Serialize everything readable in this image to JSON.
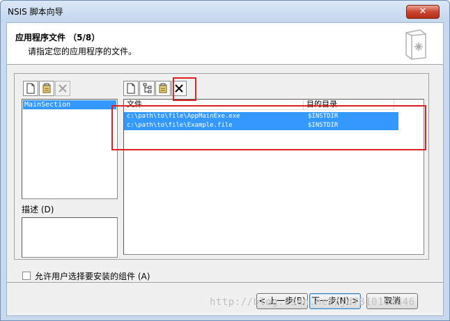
{
  "window": {
    "title": "NSIS 脚本向导",
    "close_glyph": "✕"
  },
  "header": {
    "title": "应用程序文件 （5/8）",
    "subtitle": "请指定您的应用程序的文件。"
  },
  "sections_panel": {
    "items": [
      "MainSection"
    ],
    "description_label": "描述 (D)"
  },
  "files_panel": {
    "columns": [
      "文件",
      "目的目录"
    ],
    "rows": [
      {
        "file": "c:\\path\\to\\file\\AppMainExe.exe",
        "dest": "$INSTDIR"
      },
      {
        "file": "c:\\path\\to\\file\\Example.file",
        "dest": "$INSTDIR"
      }
    ]
  },
  "options": {
    "allow_select_label": "允许用户选择要安装的组件 (A)"
  },
  "buttons": {
    "back": "< 上一步(B)",
    "next": "下一步(N) >",
    "cancel": "取消"
  },
  "watermark": "http://blog.csdn.net/jd7810184446",
  "colors": {
    "selection": "#3399ff",
    "annotation_red": "#e02020"
  }
}
